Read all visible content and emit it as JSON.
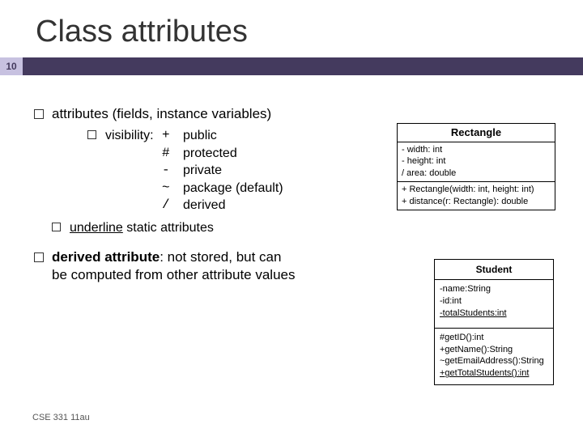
{
  "slide": {
    "number": "10",
    "title": "Class attributes",
    "footer": "CSE 331 11au"
  },
  "bullets": {
    "b1": "attributes (fields, instance variables)",
    "b2_vis_label": "visibility:",
    "vis": [
      {
        "sym": "+",
        "label": "public"
      },
      {
        "sym": "#",
        "label": "protected"
      },
      {
        "sym": "-",
        "label": "private"
      },
      {
        "sym": "~",
        "label": "package (default)"
      },
      {
        "sym": "/",
        "label": "derived"
      }
    ],
    "b2_underline_pre": "underline",
    "b2_underline_post": " static attributes",
    "derived_strong": "derived attribute",
    "derived_rest": ": not stored, but can\nbe computed from other attribute values"
  },
  "uml_rect": {
    "name": "Rectangle",
    "attrs": [
      "- width: int",
      "- height: int",
      "/ area: double"
    ],
    "ops": [
      "+ Rectangle(width: int, height: int)",
      "+ distance(r: Rectangle): double"
    ]
  },
  "uml_student": {
    "name": "Student",
    "attrs": [
      "-name:String",
      "-id:int",
      "-totalStudents:int"
    ],
    "ops": [
      "#getID():int",
      "+getName():String",
      "~getEmailAddress():String",
      "+getTotalStudents():int"
    ]
  }
}
